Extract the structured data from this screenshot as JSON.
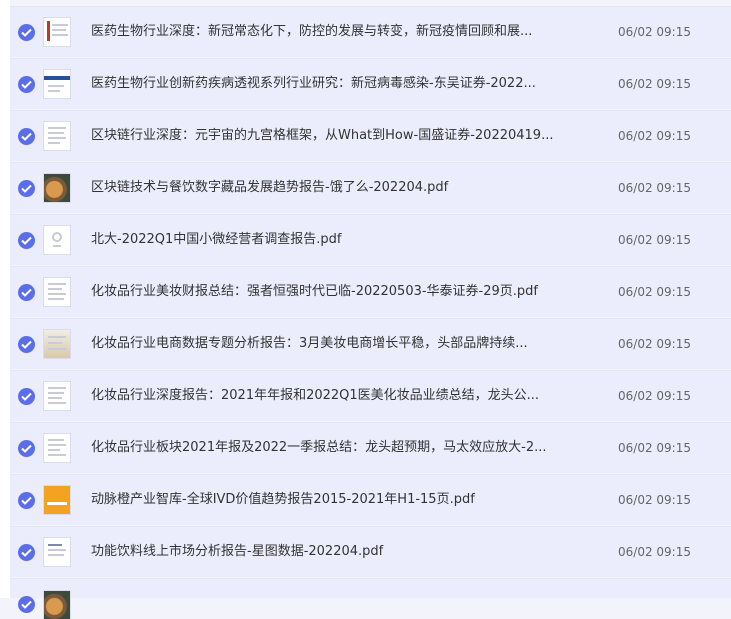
{
  "files": [
    {
      "title": "医药生物行业深度：新冠常态化下，防控的发展与转变，新冠疫情回顾和展...",
      "time": "06/02 09:15",
      "thumb": "red-doc-icon"
    },
    {
      "title": "医药生物行业创新药疾病透视系列行业研究：新冠病毒感染-东吴证券-2022...",
      "time": "06/02 09:15",
      "thumb": "blue-doc-icon"
    },
    {
      "title": "区块链行业深度：元宇宙的九宫格框架，从What到How-国盛证券-20220419...",
      "time": "06/02 09:15",
      "thumb": "doc-icon"
    },
    {
      "title": "区块链技术与餐饮数字藏品发展趋势报告-饿了么-202204.pdf",
      "time": "06/02 09:15",
      "thumb": "photo-icon"
    },
    {
      "title": "北大-2022Q1中国小微经营者调查报告.pdf",
      "time": "06/02 09:15",
      "thumb": "cover-icon"
    },
    {
      "title": "化妆品行业美妆财报总结：强者恒强时代已临-20220503-华泰证券-29页.pdf",
      "time": "06/02 09:15",
      "thumb": "doc-icon"
    },
    {
      "title": "化妆品行业电商数据专题分析报告：3月美妆电商增长平稳，头部品牌持续...",
      "time": "06/02 09:15",
      "thumb": "doc-icon"
    },
    {
      "title": "化妆品行业深度报告：2021年年报和2022Q1医美化妆品业绩总结，龙头公...",
      "time": "06/02 09:15",
      "thumb": "doc-icon"
    },
    {
      "title": "化妆品行业板块2021年报及2022一季报总结：龙头超预期，马太效应放大-2...",
      "time": "06/02 09:15",
      "thumb": "doc-icon"
    },
    {
      "title": "动脉橙产业智库-全球IVD价值趋势报告2015-2021年H1-15页.pdf",
      "time": "06/02 09:15",
      "thumb": "orange-doc-icon"
    },
    {
      "title": "功能饮料线上市场分析报告-星图数据-202204.pdf",
      "time": "06/02 09:15",
      "thumb": "doc-icon"
    }
  ]
}
